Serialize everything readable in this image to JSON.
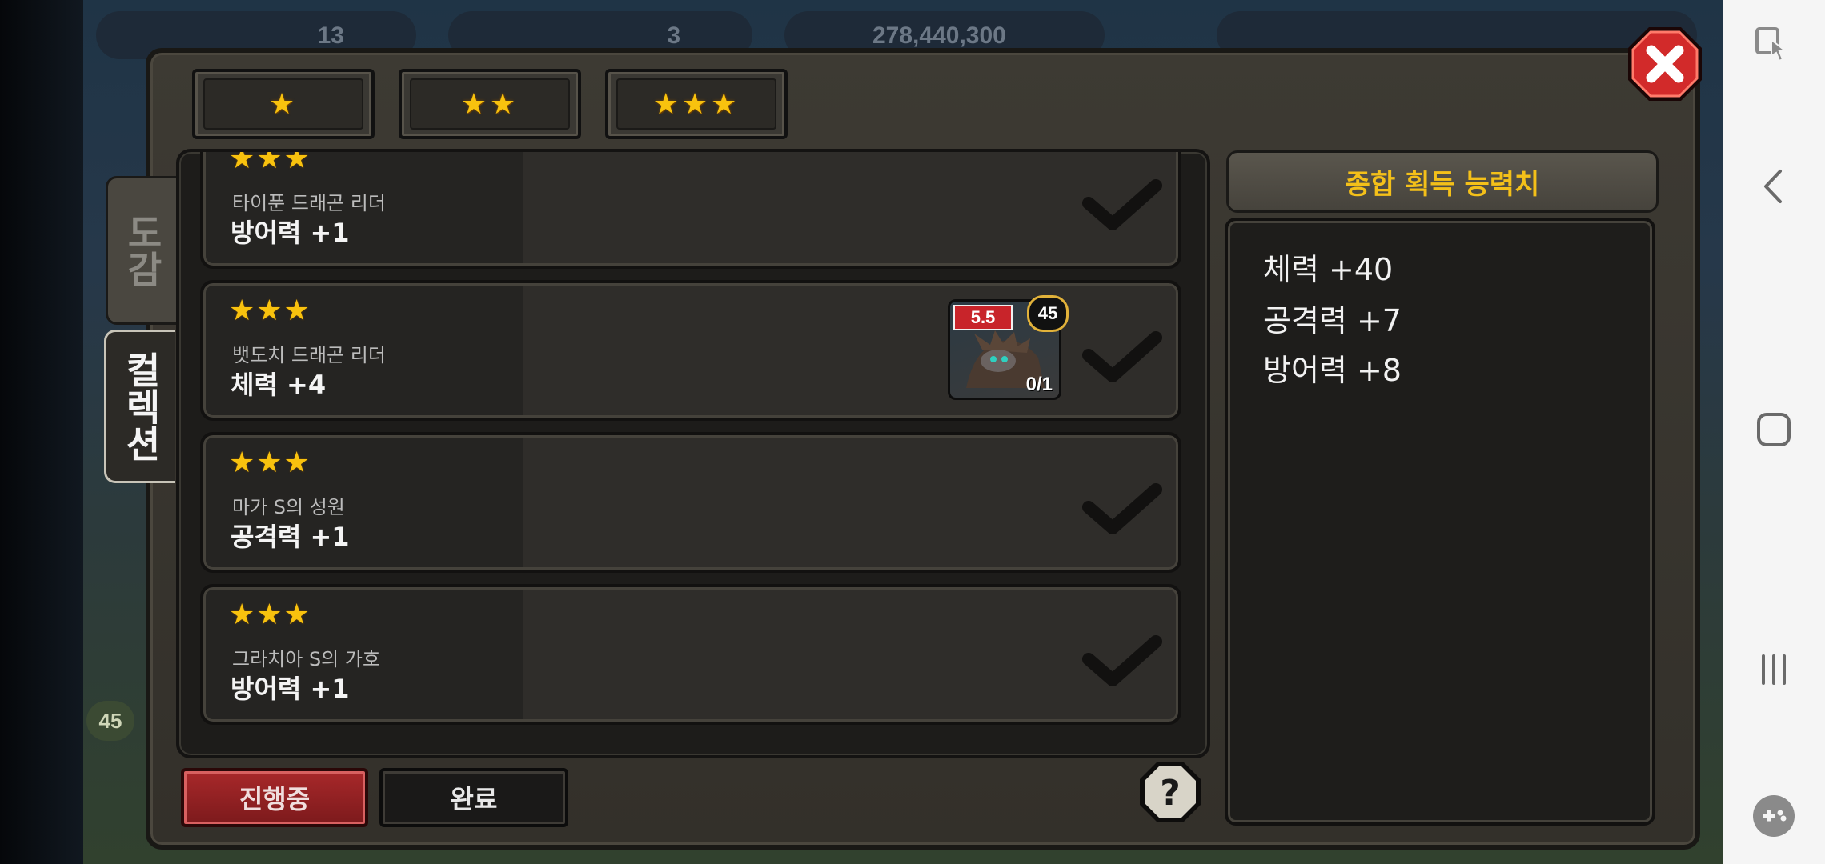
{
  "hud": {
    "hearts": "13",
    "gems": "3",
    "coins": "278,440,300"
  },
  "star_filters": [
    "★",
    "★★",
    "★★★"
  ],
  "side_tabs": [
    {
      "label": "도감"
    },
    {
      "label": "컬렉션"
    }
  ],
  "collection_items": [
    {
      "stars": "★★★",
      "name": "타이푼 드래곤 리더",
      "stat": "방어력 +1",
      "has_card": false
    },
    {
      "stars": "★★★",
      "name": "뱃도치 드래곤 리더",
      "stat": "체력 +4",
      "has_card": true,
      "card_label": "5.5",
      "card_level": "45",
      "card_count": "0/1"
    },
    {
      "stars": "★★★",
      "name": "마가 S의 성원",
      "stat": "공격력 +1",
      "has_card": false
    },
    {
      "stars": "★★★",
      "name": "그라치아 S의 가호",
      "stat": "방어력 +1",
      "has_card": false
    }
  ],
  "summary": {
    "title": "종합 획득 능력치",
    "stats": [
      "체력 +40",
      "공격력 +7",
      "방어력 +8"
    ]
  },
  "bottom_tabs": {
    "in_progress": "진행중",
    "complete": "완료"
  },
  "left_badge": "45",
  "colors": {
    "gold": "#f4c019",
    "active_tab": "#8a1e1e",
    "panel": "#33302a"
  }
}
